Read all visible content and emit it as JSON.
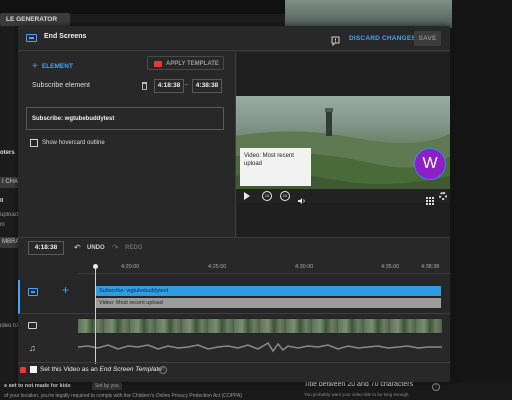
{
  "background": {
    "generator_label": "LE GENERATOR",
    "side_text_1": "oters",
    "chip_1": "I CHA",
    "side_text_2": "ll",
    "side_text_3": "upload",
    "side_text_4": "ni",
    "chip_2": "MBRA",
    "side_text_5": "ideo to",
    "footer_line_1": "s set to not made for kids",
    "footer_set_by": "Set by you",
    "footer_line_2": "of your location, you're legally required to comply with the Children's Online Privacy Protection Act (COPPA)",
    "footer_right_title": "Title between 20 and 70 characters",
    "footer_right_sub": "You probably want your video title to be long enough"
  },
  "header": {
    "title": "End Screens",
    "discard_label": "DISCARD CHANGES",
    "save_label": "SAVE"
  },
  "editor": {
    "add_element_label": "ELEMENT",
    "apply_template_label": "APPLY TEMPLATE",
    "element_name": "Subscribe element",
    "start_time": "4:18:38",
    "time_separator": "–",
    "end_time": "4:38:38",
    "subscribe_field_value": "Subscribe: wgtubebuddytest",
    "hovercard_label": "Show hovercard outline"
  },
  "preview": {
    "card_text": "Video: Most recent upload",
    "avatar_letter": "W",
    "replay_10": "10",
    "forward_10": "10"
  },
  "timeline": {
    "current_time": "4:18:38",
    "undo_label": "UNDO",
    "redo_label": "REDO",
    "ruler": [
      "4:20:00",
      "4:25:00",
      "4:30:00",
      "4:35:00",
      "4:38:38"
    ],
    "subscribe_bar": "Subscribe: wgtubebuddytest",
    "video_bar": "Video: Most recent upload"
  },
  "template": {
    "label_prefix": "Set this Video as an",
    "label_emphasis": "End Screen Template"
  },
  "colors": {
    "accent_blue": "#3ea6ff",
    "subscribe_bar": "#2f9be3",
    "video_bar": "#9c9c9c",
    "avatar": "#8e1fc6",
    "red_icon": "#e53935"
  }
}
